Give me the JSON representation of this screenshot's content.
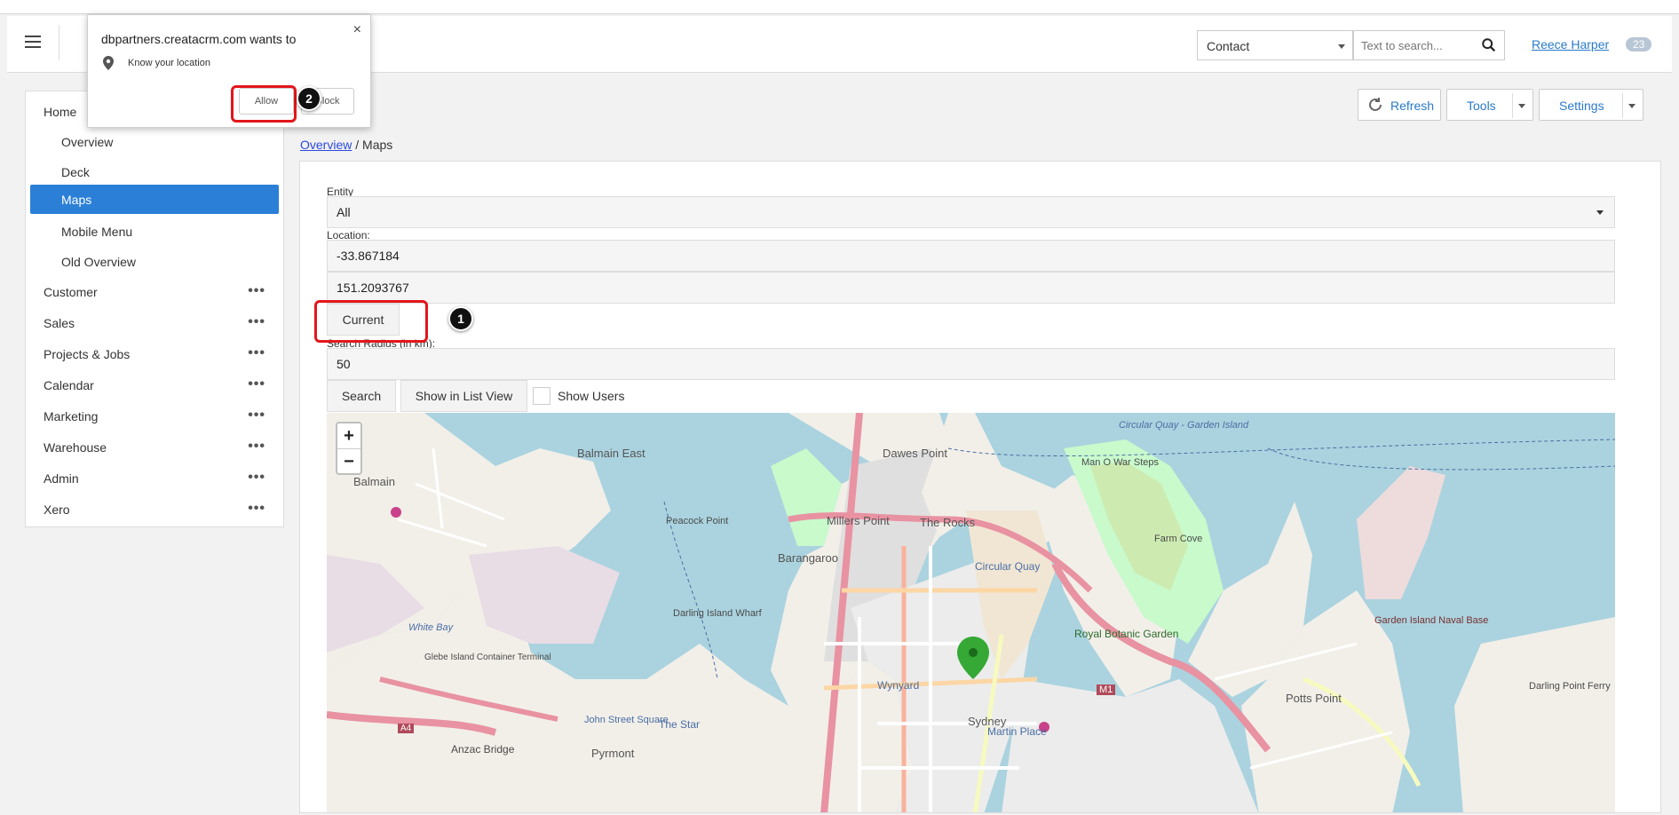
{
  "topbar": {
    "entity_select": "Contact",
    "search_placeholder": "Text to search...",
    "user_name": "Reece Harper",
    "notification_count": "23"
  },
  "sidebar": {
    "items": [
      {
        "label": "Home"
      },
      {
        "label": "Overview"
      },
      {
        "label": "Deck"
      },
      {
        "label": "Maps"
      },
      {
        "label": "Mobile Menu"
      },
      {
        "label": "Old Overview"
      },
      {
        "label": "Customer"
      },
      {
        "label": "Sales"
      },
      {
        "label": "Projects & Jobs"
      },
      {
        "label": "Calendar"
      },
      {
        "label": "Marketing"
      },
      {
        "label": "Warehouse"
      },
      {
        "label": "Admin"
      },
      {
        "label": "Xero"
      }
    ],
    "more_glyph": "•••"
  },
  "toolbar": {
    "refresh_label": "Refresh",
    "tools_label": "Tools",
    "settings_label": "Settings"
  },
  "breadcrumb": {
    "parent": "Overview",
    "separator": " / ",
    "current": "Maps"
  },
  "form": {
    "entity_label": "Entity",
    "entity_value": "All",
    "location_label": "Location:",
    "latitude": "-33.867184",
    "longitude": "151.2093767",
    "current_button": "Current",
    "radius_label": "Search Radius (in km):",
    "radius_value": "50",
    "search_button": "Search",
    "list_view_button": "Show in List View",
    "show_users_label": "Show Users"
  },
  "map": {
    "zoom_in": "+",
    "zoom_out": "−",
    "labels": {
      "balmain": "Balmain",
      "balmain_east": "Balmain East",
      "dawes_point": "Dawes Point",
      "millers_point": "Millers Point",
      "the_rocks": "The Rocks",
      "barangaroo": "Barangaroo",
      "circular_quay": "Circular Quay",
      "royal_botanic": "Royal Botanic Garden",
      "sydney": "Sydney",
      "martin_place": "Martin Place",
      "wynyard": "Wynyard",
      "pyrmont": "Pyrmont",
      "the_star": "The Star",
      "john_street_square": "John Street Square",
      "anzac_bridge": "Anzac Bridge",
      "potts_point": "Potts Point",
      "garden_island": "Garden Island Naval Base",
      "farm_cove": "Farm Cove",
      "peacock_point": "Peacock Point",
      "darling_island_wharf": "Darling Island Wharf",
      "glebe_island": "Glebe Island Container Terminal",
      "white_bay": "White Bay",
      "circular_quay_ferry": "Circular Quay - Garden Island",
      "man_o_war": "Man O War Steps",
      "darling_point_ferry": "Darling Point Ferry",
      "m1": "M1",
      "a4": "A4"
    }
  },
  "permission_popup": {
    "title": "dbpartners.creatacrm.com wants to",
    "permission": "Know your location",
    "allow": "Allow",
    "block": "Block",
    "close": "×"
  },
  "annotations": {
    "step1": "1",
    "step2": "2"
  },
  "colors": {
    "accent": "#2b7fd7",
    "highlight": "#e3161b",
    "map_water": "#aad3df",
    "map_land": "#f2efe9",
    "map_park": "#c8facc"
  }
}
